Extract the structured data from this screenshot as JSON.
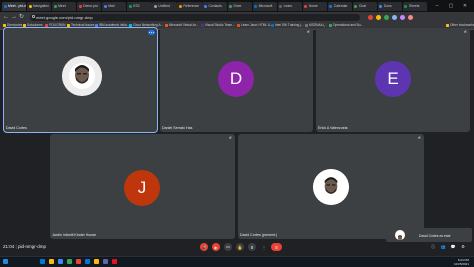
{
  "browser": {
    "tabs": [
      {
        "label": "Meet - pid-nmgr-dmp",
        "favicon_color": "#1a73e8",
        "active": true
      },
      {
        "label": "Navigation",
        "favicon_color": "#fbbc04"
      },
      {
        "label": "Meet",
        "favicon_color": "#34a853"
      },
      {
        "label": "Demo pro",
        "favicon_color": "#ea4335"
      },
      {
        "label": "Mail",
        "favicon_color": "#4285f4"
      },
      {
        "label": "ES2",
        "favicon_color": "#0f9d58"
      },
      {
        "label": "Untitled",
        "favicon_color": "#9aa0a6"
      },
      {
        "label": "Reference",
        "favicon_color": "#f29900"
      },
      {
        "label": "Contacts",
        "favicon_color": "#4285f4"
      },
      {
        "label": "Drive",
        "favicon_color": "#34a853"
      },
      {
        "label": "Microsoft",
        "favicon_color": "#0078d4"
      },
      {
        "label": "Learn",
        "favicon_color": "#5f6368"
      },
      {
        "label": "Home",
        "favicon_color": "#ea4335"
      },
      {
        "label": "Calendar",
        "favicon_color": "#1a73e8"
      },
      {
        "label": "Chat",
        "favicon_color": "#34a853"
      },
      {
        "label": "Docs",
        "favicon_color": "#4285f4"
      },
      {
        "label": "Sheets",
        "favicon_color": "#0f9d58"
      }
    ],
    "window_controls": {
      "minimize": "–",
      "maximize": "▢",
      "close": "✕"
    },
    "nav_icons": {
      "back": "←",
      "forward": "→",
      "reload": "↻"
    },
    "address": "meet.google.com/pid-nmgr-dmp",
    "extension_colors": [
      "#ea4335",
      "#fbbc04",
      "#34a853",
      "#8ab4f8",
      "#c58af9",
      "#f28b82"
    ],
    "bookmarks": [
      {
        "label": "Directories",
        "color": "#fbbc04"
      },
      {
        "label": "Soluciones",
        "color": "#fbbc04"
      },
      {
        "label": "POLIGRAN",
        "color": "#ea4335"
      },
      {
        "label": "Technical Issues",
        "color": "#fbbc04"
      },
      {
        "label": "IBM academic initia...",
        "color": "#4285f4"
      },
      {
        "label": "Cisco Networking A...",
        "color": "#00bceb"
      },
      {
        "label": "Microsoft Virtual Ac...",
        "color": "#f25022"
      },
      {
        "label": "Visual Studio Team...",
        "color": "#5c2d91"
      },
      {
        "label": "Learn Java: HTML &...",
        "color": "#e34f26"
      },
      {
        "label": "Intel SW Training (...",
        "color": "#0071c5"
      },
      {
        "label": "MSDNAA (...",
        "color": "#737373"
      },
      {
        "label": "Operational and Bu...",
        "color": "#34a853"
      },
      {
        "label": "Other bookmarks",
        "color": "#fbbc04"
      }
    ]
  },
  "participants": [
    {
      "name": "David Cortes",
      "type": "photo",
      "speaking": true
    },
    {
      "name": "Daniel Serrato Has",
      "type": "initial",
      "initial": "D",
      "color": "#8e24aa"
    },
    {
      "name": "Erick A Valenzuela",
      "type": "initial",
      "initial": "E",
      "color": "#5e35b1"
    },
    {
      "name": "Jardin Infantil Kinder House",
      "type": "initial",
      "initial": "J",
      "color": "#bf360c"
    },
    {
      "name": "David Cortes (present.)",
      "type": "photo"
    }
  ],
  "self_view": {
    "name": "David Cortes es este"
  },
  "meeting": {
    "time": "21:04",
    "separator": "|",
    "code": "pid-nmgr-dmp"
  },
  "controls": {
    "mic": "🎤",
    "cam": "▶",
    "captions": "CC",
    "hand": "✋",
    "present": "⬆",
    "more": "⋮",
    "end": "✆",
    "right": [
      "ⓘ",
      "👥",
      "💬",
      "⚙"
    ]
  },
  "taskbar": {
    "clock_time": "6:04 PM",
    "clock_date": "10/25/2021",
    "icon_colors": [
      "#0078d4",
      "#fbbc04",
      "#4285f4",
      "#34a853",
      "#ea4335",
      "#0078d4",
      "#ffb900",
      "#6264a7",
      "#e81123"
    ]
  }
}
